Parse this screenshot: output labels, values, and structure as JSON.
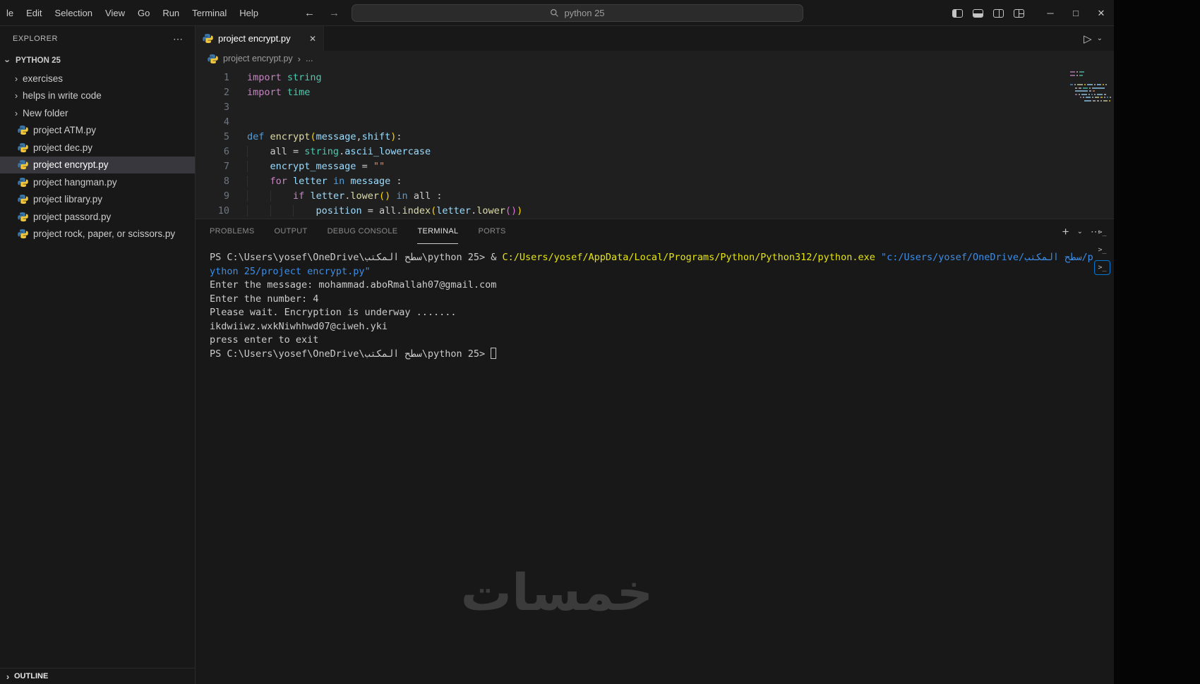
{
  "colors": {
    "kw": "#C586C0",
    "kwb": "#569CD6",
    "mod": "#4EC9B0",
    "func": "#DCDCAA",
    "var": "#9CDCFE",
    "str": "#CE9178",
    "plain": "#CCCCCC",
    "br1": "#FFD700",
    "br2": "#DA70D6",
    "term_fg": "#CCCCCC",
    "term_yellow": "#E5E510",
    "term_blue": "#3B8EEA",
    "accent": "#0078D4",
    "selection_bg": "#37373D"
  },
  "icons": {
    "back": "←",
    "forward": "→",
    "more": "⋯",
    "chev_right": "›",
    "chev_down": "›",
    "close": "✕",
    "run": "▷",
    "dropdown": "⌄",
    "plus": "+",
    "min": "─",
    "max": "□",
    "x": "✕",
    "term_chip": ">_"
  },
  "titlebar": {
    "menus": [
      "le",
      "Edit",
      "Selection",
      "View",
      "Go",
      "Run",
      "Terminal",
      "Help"
    ],
    "search_text": "python 25"
  },
  "sidebar": {
    "header": "EXPLORER",
    "section": "PYTHON 25",
    "items": [
      {
        "type": "folder",
        "label": "exercises"
      },
      {
        "type": "folder",
        "label": "helps in write code"
      },
      {
        "type": "folder",
        "label": "New folder"
      },
      {
        "type": "file",
        "label": "project ATM.py"
      },
      {
        "type": "file",
        "label": "project dec.py"
      },
      {
        "type": "file",
        "label": "project encrypt.py",
        "selected": true
      },
      {
        "type": "file",
        "label": "project hangman.py"
      },
      {
        "type": "file",
        "label": "project library.py"
      },
      {
        "type": "file",
        "label": "project passord.py"
      },
      {
        "type": "file",
        "label": "project rock, paper, or scissors.py"
      }
    ],
    "outline": "OUTLINE"
  },
  "editor": {
    "tab_label": "project encrypt.py",
    "breadcrumb": {
      "file": "project encrypt.py",
      "sep": "›",
      "more": "..."
    },
    "code": [
      [
        {
          "c": "kw",
          "t": "import"
        },
        {
          "c": "plain",
          "t": " "
        },
        {
          "c": "mod",
          "t": "string"
        }
      ],
      [
        {
          "c": "kw",
          "t": "import"
        },
        {
          "c": "plain",
          "t": " "
        },
        {
          "c": "mod",
          "t": "time"
        }
      ],
      [],
      [],
      [
        {
          "c": "kwb",
          "t": "def"
        },
        {
          "c": "plain",
          "t": " "
        },
        {
          "c": "func",
          "t": "encrypt"
        },
        {
          "c": "br1",
          "t": "("
        },
        {
          "c": "var",
          "t": "message"
        },
        {
          "c": "plain",
          "t": ","
        },
        {
          "c": "var",
          "t": "shift"
        },
        {
          "c": "br1",
          "t": ")"
        },
        {
          "c": "plain",
          "t": ":"
        }
      ],
      [
        {
          "c": "ind",
          "t": "    "
        },
        {
          "c": "plain",
          "t": "all"
        },
        {
          "c": "plain",
          "t": " = "
        },
        {
          "c": "mod",
          "t": "string"
        },
        {
          "c": "plain",
          "t": "."
        },
        {
          "c": "var",
          "t": "ascii_lowercase"
        }
      ],
      [
        {
          "c": "ind",
          "t": "    "
        },
        {
          "c": "var",
          "t": "encrypt_message"
        },
        {
          "c": "plain",
          "t": " = "
        },
        {
          "c": "str",
          "t": "\"\""
        }
      ],
      [
        {
          "c": "ind",
          "t": "    "
        },
        {
          "c": "kw",
          "t": "for"
        },
        {
          "c": "plain",
          "t": " "
        },
        {
          "c": "var",
          "t": "letter"
        },
        {
          "c": "plain",
          "t": " "
        },
        {
          "c": "kwb",
          "t": "in"
        },
        {
          "c": "plain",
          "t": " "
        },
        {
          "c": "var",
          "t": "message"
        },
        {
          "c": "plain",
          "t": " :"
        }
      ],
      [
        {
          "c": "ind",
          "t": "    "
        },
        {
          "c": "ind",
          "t": "    "
        },
        {
          "c": "kw",
          "t": "if"
        },
        {
          "c": "plain",
          "t": " "
        },
        {
          "c": "var",
          "t": "letter"
        },
        {
          "c": "plain",
          "t": "."
        },
        {
          "c": "func",
          "t": "lower"
        },
        {
          "c": "br1",
          "t": "()"
        },
        {
          "c": "plain",
          "t": " "
        },
        {
          "c": "kwb",
          "t": "in"
        },
        {
          "c": "plain",
          "t": " "
        },
        {
          "c": "plain",
          "t": "all"
        },
        {
          "c": "plain",
          "t": " :"
        }
      ],
      [
        {
          "c": "ind",
          "t": "    "
        },
        {
          "c": "ind",
          "t": "    "
        },
        {
          "c": "ind",
          "t": "    "
        },
        {
          "c": "var",
          "t": "position"
        },
        {
          "c": "plain",
          "t": " = "
        },
        {
          "c": "plain",
          "t": "all"
        },
        {
          "c": "plain",
          "t": "."
        },
        {
          "c": "func",
          "t": "index"
        },
        {
          "c": "br1",
          "t": "("
        },
        {
          "c": "var",
          "t": "letter"
        },
        {
          "c": "plain",
          "t": "."
        },
        {
          "c": "func",
          "t": "lower"
        },
        {
          "c": "br2",
          "t": "()"
        },
        {
          "c": "br1",
          "t": ")"
        }
      ]
    ]
  },
  "panel": {
    "tabs": [
      {
        "label": "PROBLEMS"
      },
      {
        "label": "OUTPUT"
      },
      {
        "label": "DEBUG CONSOLE"
      },
      {
        "label": "TERMINAL",
        "active": true
      },
      {
        "label": "PORTS"
      }
    ],
    "terminal": [
      [
        {
          "c": "term_fg",
          "t": "PS C:\\Users\\yosef\\OneDrive\\سطح المكتب\\python 25> & "
        },
        {
          "c": "term_yellow",
          "t": "C:/Users/yosef/AppData/Local/Programs/Python/Python312/python.exe"
        },
        {
          "c": "term_fg",
          "t": " "
        },
        {
          "c": "term_blue",
          "t": "\"c:/Users/yosef/OneDrive/سطح المكتب/p"
        }
      ],
      [
        {
          "c": "term_blue",
          "t": "ython 25/project encrypt.py\""
        }
      ],
      [
        {
          "c": "term_fg",
          "t": "Enter the message: mohammad.aboRmallah07@gmail.com"
        }
      ],
      [
        {
          "c": "term_fg",
          "t": "Enter the number: 4"
        }
      ],
      [
        {
          "c": "term_fg",
          "t": "Please wait. Encryption is underway ......."
        }
      ],
      [
        {
          "c": "term_fg",
          "t": "ikdwiiwz.wxkNiwhhwd07@ciweh.yki"
        }
      ],
      [
        {
          "c": "term_fg",
          "t": "press enter to exit"
        }
      ],
      [
        {
          "c": "term_fg",
          "t": "PS C:\\Users\\yosef\\OneDrive\\سطح المكتب\\python 25> "
        },
        {
          "c": "cursor",
          "t": ""
        }
      ]
    ]
  },
  "watermark": "خمسات"
}
